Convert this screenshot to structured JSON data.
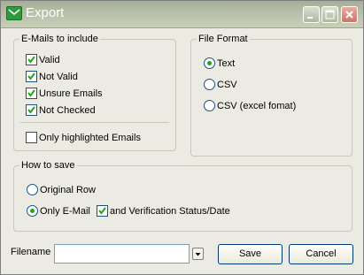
{
  "window": {
    "title": "Export",
    "controls": [
      "minimize-icon",
      "maximize-icon",
      "close-icon"
    ]
  },
  "emails_group": {
    "legend": "E-Mails to include",
    "options": [
      {
        "label": "Valid",
        "checked": true
      },
      {
        "label": "Not Valid",
        "checked": true
      },
      {
        "label": "Unsure Emails",
        "checked": true
      },
      {
        "label": "Not Checked",
        "checked": true
      }
    ],
    "highlighted": {
      "label": "Only highlighted Emails",
      "checked": false
    }
  },
  "format_group": {
    "legend": "File Format",
    "options": [
      {
        "label": "Text",
        "selected": true
      },
      {
        "label": "CSV",
        "selected": false
      },
      {
        "label": "CSV (excel fomat)",
        "selected": false
      }
    ]
  },
  "save_group": {
    "legend": "How to save",
    "original_row": {
      "label": "Original Row",
      "selected": false
    },
    "only_email": {
      "label": "Only E-Mail",
      "selected": true
    },
    "verification": {
      "label": "and Verification Status/Date",
      "checked": true
    }
  },
  "footer": {
    "filename_label": "Filename",
    "filename_value": "",
    "save_label": "Save",
    "cancel_label": "Cancel"
  },
  "colors": {
    "titlebar": "#b5bea6",
    "dialog_bg": "#ecebe3",
    "check_mark": "#21a121",
    "control_border": "#1c5180",
    "button_border": "#003c74"
  }
}
